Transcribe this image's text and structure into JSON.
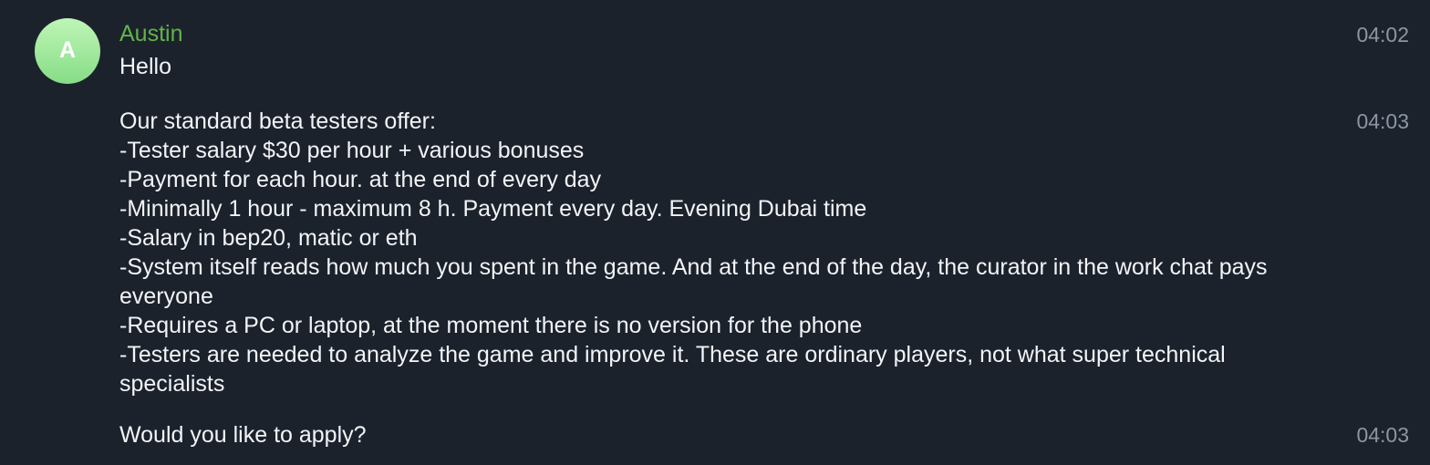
{
  "sender": {
    "name": "Austin",
    "avatar_letter": "A",
    "name_color": "#62b34a"
  },
  "messages": [
    {
      "text": "Hello",
      "time": "04:02"
    },
    {
      "text": "Our standard beta testers offer:\n-Tester salary $30 per hour + various bonuses\n-Payment for each hour. at the end of every day\n-Minimally 1 hour - maximum 8 h. Payment every day. Evening Dubai time\n-Salary in bep20, matic or eth\n-System itself reads how much you spent in the game. And at the end of the day, the curator in the work chat pays everyone\n-Requires a PC or laptop, at the moment there is no version for the phone\n-Testers are needed to analyze the game and improve it. These are ordinary players, not what super technical specialists",
      "time": "04:03"
    },
    {
      "text": "Would you like to apply?",
      "time": "04:03"
    }
  ],
  "colors": {
    "background": "#1c222c",
    "text": "#f2f4f7",
    "timestamp": "#8c96a3",
    "avatar_gradient_top": "#bff5b6",
    "avatar_gradient_bottom": "#86dd87"
  }
}
